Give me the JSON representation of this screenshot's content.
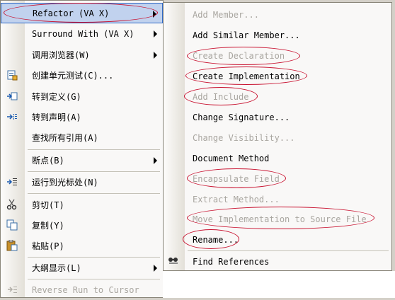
{
  "main_menu": {
    "items": [
      {
        "label": "Refactor (VA X)",
        "highlighted": true,
        "submenu": true,
        "icon": ""
      },
      {
        "label": "Surround With (VA X)",
        "submenu": true,
        "icon": ""
      },
      {
        "label": "调用浏览器(W)",
        "submenu": true,
        "icon": ""
      },
      {
        "label": "创建单元测试(C)...",
        "icon": "unit-test-icon"
      },
      {
        "label": "转到定义(G)",
        "icon": "go-to-definition-icon"
      },
      {
        "label": "转到声明(A)",
        "icon": "go-to-declaration-icon"
      },
      {
        "label": "查找所有引用(A)",
        "icon": ""
      },
      {
        "label": "断点(B)",
        "submenu": true,
        "icon": ""
      },
      {
        "label": "运行到光标处(N)",
        "icon": "run-to-cursor-icon"
      },
      {
        "label": "剪切(T)",
        "icon": "scissors-icon"
      },
      {
        "label": "复制(Y)",
        "icon": "copy-icon"
      },
      {
        "label": "粘贴(P)",
        "icon": "paste-icon"
      },
      {
        "label": "大纲显示(L)",
        "submenu": true,
        "icon": ""
      }
    ],
    "disabled_item": "Reverse Run to Cursor"
  },
  "submenu": {
    "items": [
      {
        "label": "Add Member...",
        "disabled": true,
        "circled": false
      },
      {
        "label": "Add Similar Member...",
        "disabled": false,
        "circled": false
      },
      {
        "label": "Create Declaration",
        "disabled": true,
        "circled": true
      },
      {
        "label": "Create Implementation",
        "disabled": false,
        "circled": true
      },
      {
        "label": "Add Include",
        "disabled": true,
        "circled": true
      },
      {
        "label": "Change Signature...",
        "disabled": false,
        "circled": false
      },
      {
        "label": "Change Visibility...",
        "disabled": true,
        "circled": false
      },
      {
        "label": "Document Method",
        "disabled": false,
        "circled": false
      },
      {
        "label": "Encapsulate Field",
        "disabled": true,
        "circled": true
      },
      {
        "label": "Extract Method...",
        "disabled": true,
        "circled": false
      },
      {
        "label": "Move Implementation to Source File",
        "disabled": true,
        "circled": true
      },
      {
        "label": "Rename...",
        "disabled": false,
        "circled": true
      },
      {
        "label": "Find References",
        "disabled": false,
        "circled": false,
        "icon": "find-references-icon"
      }
    ]
  },
  "colors": {
    "highlight_bg": "#c1d2ee",
    "highlight_border": "#316ac5",
    "annotation_red": "#c8102e",
    "disabled_text": "#a9a6a0"
  }
}
